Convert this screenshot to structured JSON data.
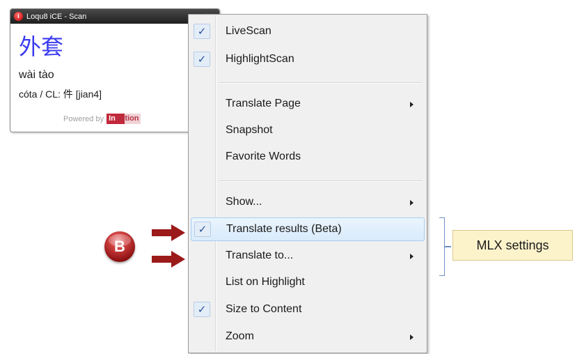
{
  "scan_window": {
    "title": "Loqu8 iCE - Scan",
    "app_icon_glyph": "i",
    "controls_glyph": "◢✕",
    "hanzi": "外套",
    "pinyin": "wài tào",
    "definition": "cóta / CL: 件 [jian4]",
    "powered_by": "Powered by",
    "logo_box": "In",
    "logo_rest": "tuition"
  },
  "menu": {
    "items": [
      {
        "label": "LiveScan",
        "checked": true
      },
      {
        "label": "HighlightScan",
        "checked": true
      },
      {
        "label": "Translate Page",
        "submenu": true
      },
      {
        "label": "Snapshot"
      },
      {
        "label": "Favorite Words"
      },
      {
        "label": "Show...",
        "submenu": true
      },
      {
        "label": "Translate results (Beta)",
        "checked": true,
        "selected": true
      },
      {
        "label": "Translate to...",
        "submenu": true
      },
      {
        "label": "List on Highlight"
      },
      {
        "label": "Size to Content",
        "checked": true
      },
      {
        "label": "Zoom",
        "submenu": true
      }
    ],
    "check_glyph": "✓"
  },
  "annotation": {
    "badge_letter": "B",
    "note_text": "MLX settings",
    "arrow_color": "#9b1a1a",
    "bracket_color": "#6d8fc6",
    "note_bg": "#fdf3cb"
  }
}
